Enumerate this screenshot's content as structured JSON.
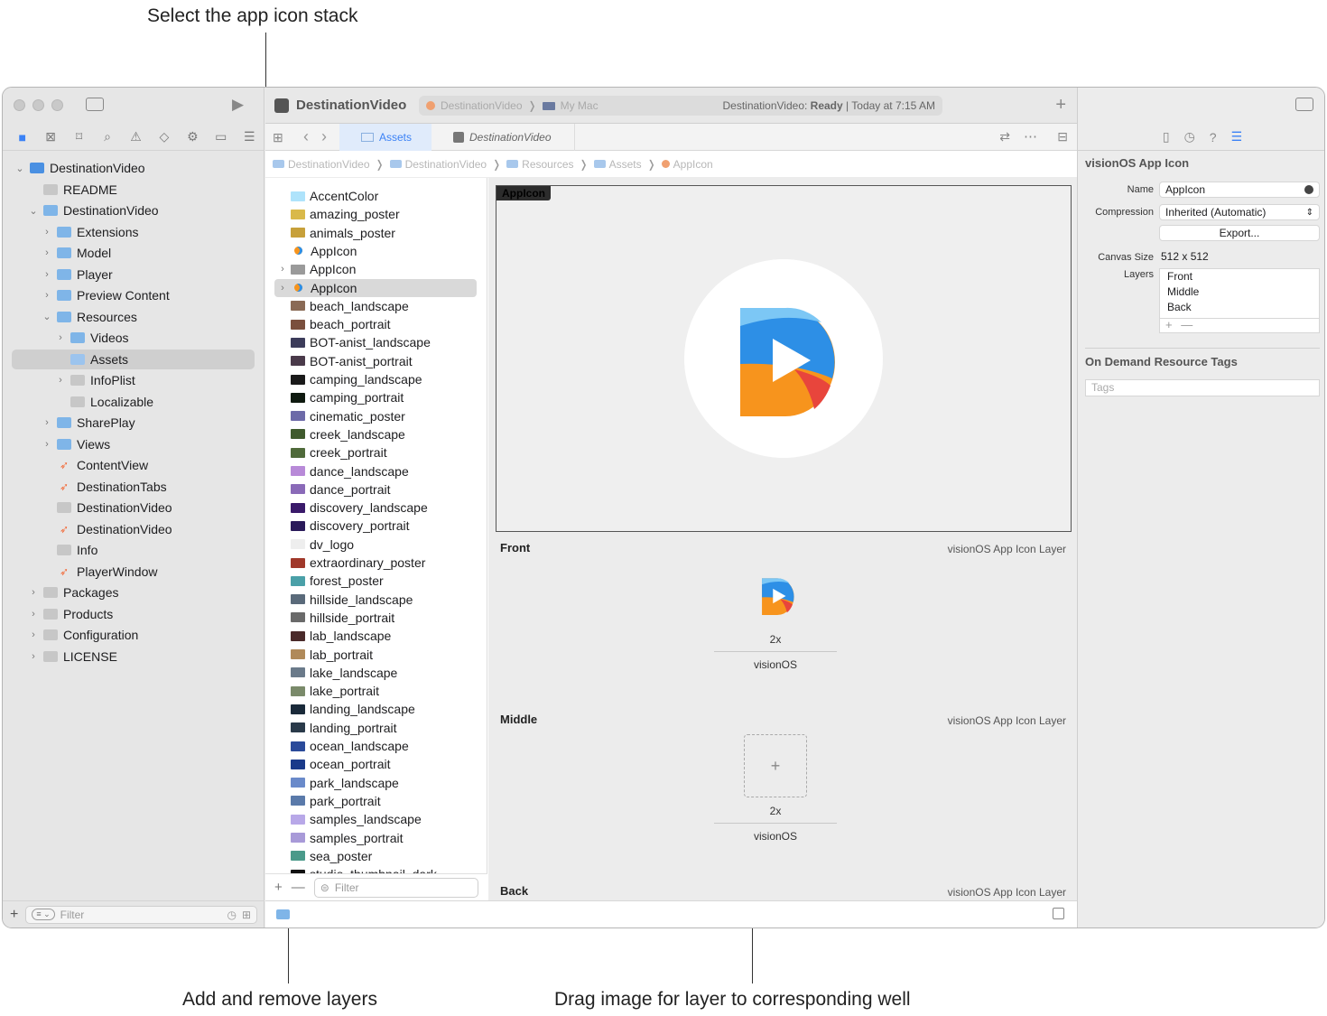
{
  "callouts": {
    "top": "Select the app icon stack",
    "bottom_left": "Add and remove layers",
    "bottom_right": "Drag image for layer to corresponding well"
  },
  "colors": {
    "accent": "#3b82f6",
    "selection": "#d9d9d9",
    "folder": "#7fb5e8"
  },
  "navigator": {
    "items": [
      {
        "label": "DestinationVideo",
        "level": 0,
        "chevron": "down",
        "icon": "project-icon"
      },
      {
        "label": "README",
        "level": 1,
        "chevron": "",
        "icon": "book-icon"
      },
      {
        "label": "DestinationVideo",
        "level": 1,
        "chevron": "down",
        "icon": "folder-icon"
      },
      {
        "label": "Extensions",
        "level": 2,
        "chevron": "right",
        "icon": "folder-icon"
      },
      {
        "label": "Model",
        "level": 2,
        "chevron": "right",
        "icon": "folder-icon"
      },
      {
        "label": "Player",
        "level": 2,
        "chevron": "right",
        "icon": "folder-icon"
      },
      {
        "label": "Preview Content",
        "level": 2,
        "chevron": "right",
        "icon": "folder-icon"
      },
      {
        "label": "Resources",
        "level": 2,
        "chevron": "down",
        "icon": "folder-icon"
      },
      {
        "label": "Videos",
        "level": 3,
        "chevron": "right",
        "icon": "folder-icon"
      },
      {
        "label": "Assets",
        "level": 3,
        "chevron": "",
        "icon": "asset-catalog-icon",
        "selected": true
      },
      {
        "label": "InfoPlist",
        "level": 3,
        "chevron": "right",
        "icon": "strings-icon"
      },
      {
        "label": "Localizable",
        "level": 3,
        "chevron": "",
        "icon": "strings-icon"
      },
      {
        "label": "SharePlay",
        "level": 2,
        "chevron": "right",
        "icon": "folder-icon"
      },
      {
        "label": "Views",
        "level": 2,
        "chevron": "right",
        "icon": "folder-icon"
      },
      {
        "label": "ContentView",
        "level": 2,
        "chevron": "",
        "icon": "swift-icon"
      },
      {
        "label": "DestinationTabs",
        "level": 2,
        "chevron": "",
        "icon": "swift-icon"
      },
      {
        "label": "DestinationVideo",
        "level": 2,
        "chevron": "",
        "icon": "entitlements-icon"
      },
      {
        "label": "DestinationVideo",
        "level": 2,
        "chevron": "",
        "icon": "swift-icon"
      },
      {
        "label": "Info",
        "level": 2,
        "chevron": "",
        "icon": "plist-icon"
      },
      {
        "label": "PlayerWindow",
        "level": 2,
        "chevron": "",
        "icon": "swift-icon"
      },
      {
        "label": "Packages",
        "level": 1,
        "chevron": "right",
        "icon": "gray-folder-icon"
      },
      {
        "label": "Products",
        "level": 1,
        "chevron": "right",
        "icon": "gray-folder-icon"
      },
      {
        "label": "Configuration",
        "level": 1,
        "chevron": "right",
        "icon": "gray-folder-icon"
      },
      {
        "label": "LICENSE",
        "level": 1,
        "chevron": "right",
        "icon": "gray-folder-icon"
      }
    ],
    "filter_placeholder": "Filter"
  },
  "toolbar": {
    "app_name": "DestinationVideo",
    "scheme": "DestinationVideo",
    "destination": "My Mac",
    "status_prefix": "DestinationVideo: ",
    "status_state": "Ready",
    "status_time": " | Today at 7:15 AM"
  },
  "tabs": [
    {
      "label": "Assets",
      "active": true
    },
    {
      "label": "DestinationVideo",
      "active": false
    }
  ],
  "breadcrumbs": [
    "DestinationVideo",
    "DestinationVideo",
    "Resources",
    "Assets",
    "AppIcon"
  ],
  "asset_list": {
    "items": [
      {
        "label": "AccentColor",
        "thumb": "#aee3fb"
      },
      {
        "label": "amazing_poster",
        "thumb": "#d9b94a"
      },
      {
        "label": "animals_poster",
        "thumb": "#c7a03a"
      },
      {
        "label": "AppIcon",
        "thumb": "appicon"
      },
      {
        "label": "AppIcon",
        "thumb": "folder",
        "chevron": true
      },
      {
        "label": "AppIcon",
        "thumb": "appicon",
        "chevron": true,
        "selected": true
      },
      {
        "label": "beach_landscape",
        "thumb": "#8a6a55"
      },
      {
        "label": "beach_portrait",
        "thumb": "#7a4f3d"
      },
      {
        "label": "BOT-anist_landscape",
        "thumb": "#3c3c5a"
      },
      {
        "label": "BOT-anist_portrait",
        "thumb": "#4a3a4a"
      },
      {
        "label": "camping_landscape",
        "thumb": "#1a1a1a"
      },
      {
        "label": "camping_portrait",
        "thumb": "#0f1a10"
      },
      {
        "label": "cinematic_poster",
        "thumb": "#6d6aa8"
      },
      {
        "label": "creek_landscape",
        "thumb": "#3f5a2d"
      },
      {
        "label": "creek_portrait",
        "thumb": "#4f6a3a"
      },
      {
        "label": "dance_landscape",
        "thumb": "#b88ad8"
      },
      {
        "label": "dance_portrait",
        "thumb": "#8a6ab8"
      },
      {
        "label": "discovery_landscape",
        "thumb": "#3a1a6a"
      },
      {
        "label": "discovery_portrait",
        "thumb": "#2a1a5a"
      },
      {
        "label": "dv_logo",
        "thumb": "#eeeeee"
      },
      {
        "label": "extraordinary_poster",
        "thumb": "#a0382a"
      },
      {
        "label": "forest_poster",
        "thumb": "#4aa0a8"
      },
      {
        "label": "hillside_landscape",
        "thumb": "#5a6a7a"
      },
      {
        "label": "hillside_portrait",
        "thumb": "#6a6a6a"
      },
      {
        "label": "lab_landscape",
        "thumb": "#4a2a2a"
      },
      {
        "label": "lab_portrait",
        "thumb": "#b08a5a"
      },
      {
        "label": "lake_landscape",
        "thumb": "#6a7a8a"
      },
      {
        "label": "lake_portrait",
        "thumb": "#7a8a6a"
      },
      {
        "label": "landing_landscape",
        "thumb": "#1a2a3a"
      },
      {
        "label": "landing_portrait",
        "thumb": "#2a3a4a"
      },
      {
        "label": "ocean_landscape",
        "thumb": "#2a4a9a"
      },
      {
        "label": "ocean_portrait",
        "thumb": "#1a3a8a"
      },
      {
        "label": "park_landscape",
        "thumb": "#6a8aca"
      },
      {
        "label": "park_portrait",
        "thumb": "#5a7aaa"
      },
      {
        "label": "samples_landscape",
        "thumb": "#b8a8e8"
      },
      {
        "label": "samples_portrait",
        "thumb": "#a89ad8"
      },
      {
        "label": "sea_poster",
        "thumb": "#4a9a8a"
      },
      {
        "label": "studio_thumbnail_dark",
        "thumb": "#111111"
      }
    ],
    "filter_placeholder": "Filter"
  },
  "editor": {
    "preview_tag": "AppIcon",
    "layers": [
      {
        "name": "Front",
        "kind": "visionOS App Icon Layer",
        "scale": "2x",
        "platform": "visionOS",
        "filled": true
      },
      {
        "name": "Middle",
        "kind": "visionOS App Icon Layer",
        "scale": "2x",
        "platform": "visionOS",
        "filled": false
      },
      {
        "name": "Back",
        "kind": "visionOS App Icon Layer",
        "scale": "",
        "platform": "",
        "filled": false
      }
    ]
  },
  "inspector": {
    "title": "visionOS App Icon",
    "name_label": "Name",
    "name_value": "AppIcon",
    "compression_label": "Compression",
    "compression_value": "Inherited (Automatic)",
    "export_label": "Export...",
    "canvas_label": "Canvas Size",
    "canvas_value": "512 x 512",
    "layers_label": "Layers",
    "layers": [
      "Front",
      "Middle",
      "Back"
    ],
    "odr_title": "On Demand Resource Tags",
    "tags_placeholder": "Tags"
  }
}
